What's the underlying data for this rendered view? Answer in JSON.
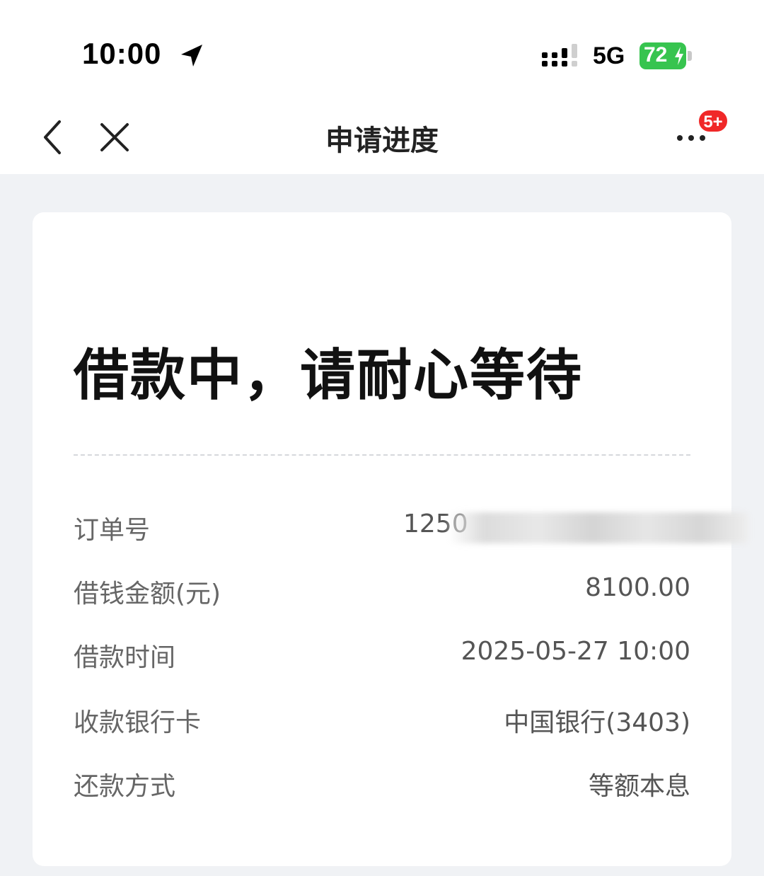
{
  "status_bar": {
    "time": "10:00",
    "network": "5G",
    "battery_level": "72",
    "battery_color": "#37c44f"
  },
  "nav": {
    "title": "申请进度",
    "back_icon": "chevron-left-icon",
    "close_icon": "close-icon",
    "more_icon": "more-dots-icon",
    "badge": "5+",
    "badge_color": "#f02828"
  },
  "card": {
    "status_title": "借款中，请耐心等待",
    "rows": [
      {
        "label": "订单号",
        "value": "1250"
      },
      {
        "label": "借钱金额(元)",
        "value": "8100.00"
      },
      {
        "label": "借款时间",
        "value": "2025-05-27 10:00"
      },
      {
        "label": "收款银行卡",
        "value": "中国银行(3403)"
      },
      {
        "label": "还款方式",
        "value": "等额本息"
      }
    ]
  }
}
